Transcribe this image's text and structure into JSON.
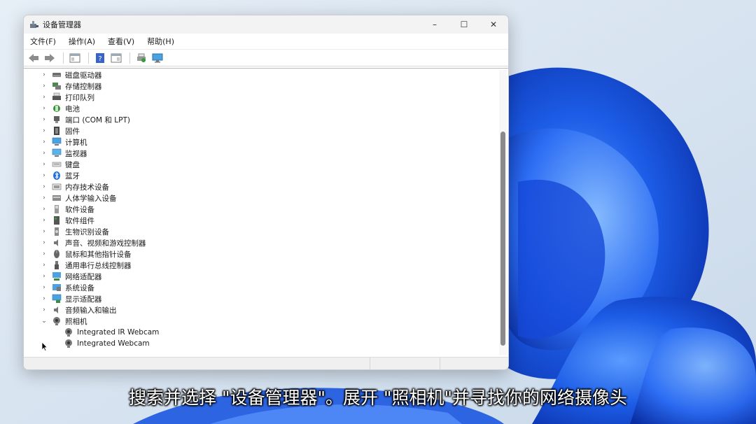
{
  "window": {
    "title": "设备管理器",
    "controls": {
      "minimize": "–",
      "maximize": "☐",
      "close": "✕"
    }
  },
  "menu": [
    "文件(F)",
    "操作(A)",
    "查看(V)",
    "帮助(H)"
  ],
  "tree": {
    "categories": [
      {
        "label": "磁盘驱动器",
        "icon": "disk-icon",
        "expanded": false
      },
      {
        "label": "存储控制器",
        "icon": "storage-controller-icon",
        "expanded": false
      },
      {
        "label": "打印队列",
        "icon": "printer-icon",
        "expanded": false
      },
      {
        "label": "电池",
        "icon": "battery-icon",
        "expanded": false
      },
      {
        "label": "端口 (COM 和 LPT)",
        "icon": "port-icon",
        "expanded": false
      },
      {
        "label": "固件",
        "icon": "firmware-icon",
        "expanded": false
      },
      {
        "label": "计算机",
        "icon": "computer-icon",
        "expanded": false
      },
      {
        "label": "监视器",
        "icon": "monitor-icon",
        "expanded": false
      },
      {
        "label": "键盘",
        "icon": "keyboard-icon",
        "expanded": false
      },
      {
        "label": "蓝牙",
        "icon": "bluetooth-icon",
        "expanded": false
      },
      {
        "label": "内存技术设备",
        "icon": "memory-icon",
        "expanded": false
      },
      {
        "label": "人体学输入设备",
        "icon": "hid-icon",
        "expanded": false
      },
      {
        "label": "软件设备",
        "icon": "software-device-icon",
        "expanded": false
      },
      {
        "label": "软件组件",
        "icon": "software-component-icon",
        "expanded": false
      },
      {
        "label": "生物识别设备",
        "icon": "biometric-icon",
        "expanded": false
      },
      {
        "label": "声音、视频和游戏控制器",
        "icon": "speaker-icon",
        "expanded": false
      },
      {
        "label": "鼠标和其他指针设备",
        "icon": "mouse-icon",
        "expanded": false
      },
      {
        "label": "通用串行总线控制器",
        "icon": "usb-icon",
        "expanded": false
      },
      {
        "label": "网络适配器",
        "icon": "network-adapter-icon",
        "expanded": false
      },
      {
        "label": "系统设备",
        "icon": "system-device-icon",
        "expanded": false
      },
      {
        "label": "显示适配器",
        "icon": "display-adapter-icon",
        "expanded": false
      },
      {
        "label": "音频输入和输出",
        "icon": "audio-io-icon",
        "expanded": false
      },
      {
        "label": "照相机",
        "icon": "camera-icon",
        "expanded": true,
        "children": [
          {
            "label": "Integrated IR Webcam",
            "icon": "webcam-icon"
          },
          {
            "label": "Integrated Webcam",
            "icon": "webcam-icon"
          }
        ]
      }
    ]
  },
  "subtitle": "搜索并选择 \"设备管理器\"。展开 \"照相机\"并寻找你的网络摄像头",
  "colors": {
    "accent": "#1f5fd6",
    "wallpaper_blue": "#0a3fd1",
    "wallpaper_bg": "#dbe6f1"
  }
}
